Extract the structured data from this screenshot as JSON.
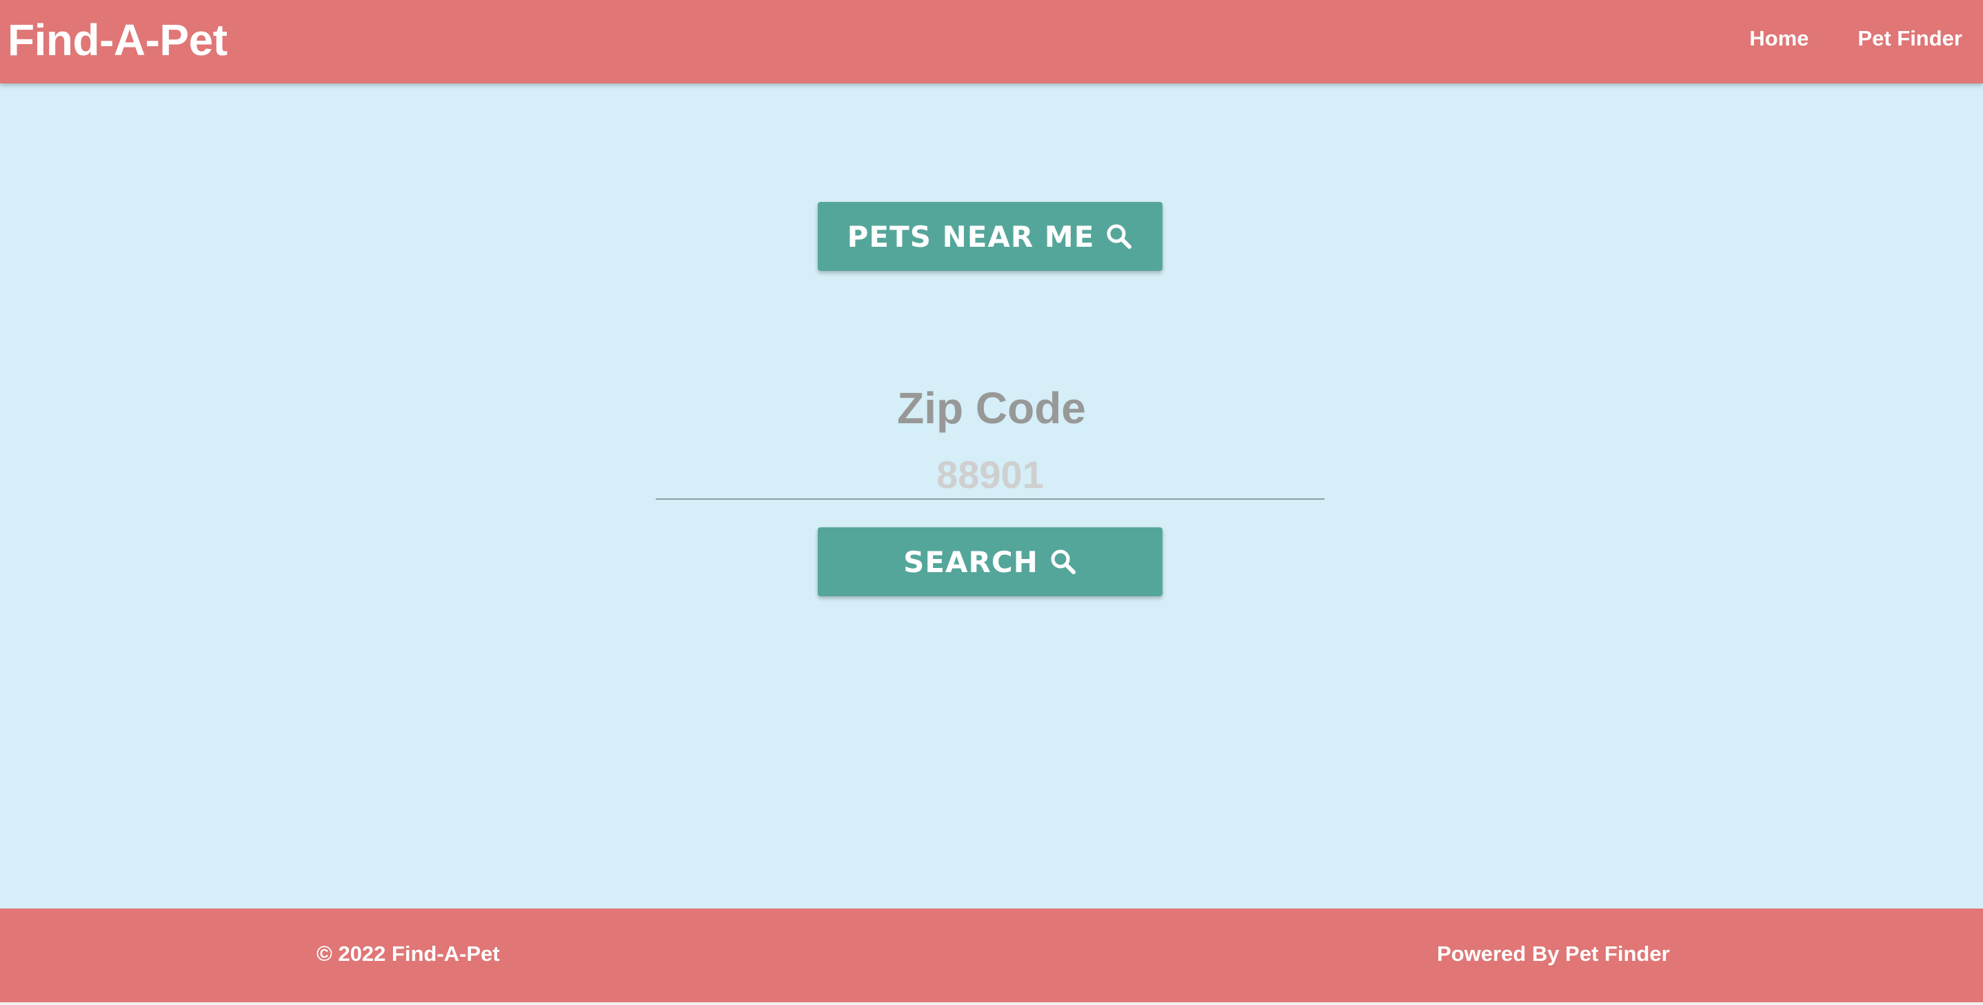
{
  "navbar": {
    "brand": "Find-A-Pet",
    "links": [
      {
        "label": "Home"
      },
      {
        "label": "Pet Finder"
      }
    ]
  },
  "main": {
    "pets_near_me_label": "PETS NEAR ME",
    "zip_label": "Zip Code",
    "zip_placeholder": "88901",
    "zip_value": "",
    "search_label": "SEARCH",
    "icon": "search-icon"
  },
  "footer": {
    "copyright": "© 2022 Find-A-Pet",
    "powered_by": "Powered By Pet Finder"
  },
  "colors": {
    "accent": "#e07676",
    "background": "#d5eef7",
    "button": "#55a69a",
    "label": "#989898",
    "placeholder": "#cfcfcf"
  }
}
